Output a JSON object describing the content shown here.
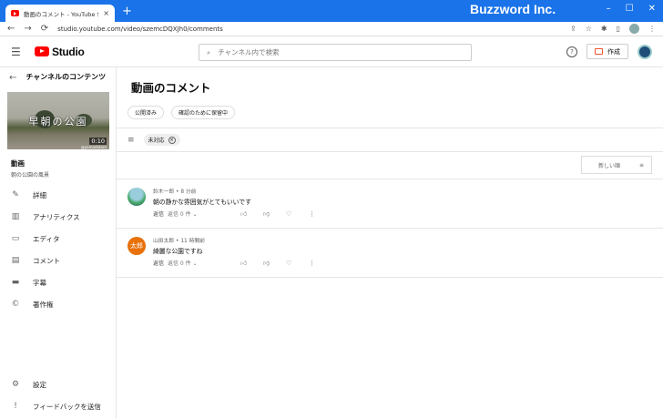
{
  "browser": {
    "tab_title": "動画のコメント - YouTube Studio",
    "tab_close": "×",
    "new_tab": "+",
    "brand": "Buzzword Inc.",
    "url": "studio.youtube.com/video/szemcDQXJh0/comments",
    "controls": [
      "–",
      "☐",
      "✕"
    ]
  },
  "header": {
    "logo_text": "Studio",
    "search_placeholder": "チャンネル内で検索",
    "create_label": "作成",
    "help": "?"
  },
  "sidebar": {
    "title": "チャンネルのコンテンツ",
    "thumb_title": "早朝の公園",
    "thumb_duration": "0:10",
    "thumb_channel": "@yamadataro",
    "video_label": "動画",
    "video_name": "朝の公園の風景",
    "items": [
      {
        "label": "詳細",
        "icon": "pencil-icon"
      },
      {
        "label": "アナリティクス",
        "icon": "analytics-icon"
      },
      {
        "label": "エディタ",
        "icon": "film-icon"
      },
      {
        "label": "コメント",
        "icon": "comment-icon"
      },
      {
        "label": "字幕",
        "icon": "subtitles-icon"
      },
      {
        "label": "著作権",
        "icon": "copyright-icon"
      }
    ],
    "bottom_items": [
      {
        "label": "設定",
        "icon": "gear-icon"
      },
      {
        "label": "フィードバックを送信",
        "icon": "feedback-icon"
      }
    ]
  },
  "main": {
    "title": "動画のコメント",
    "chips": [
      "公開済み",
      "確認のために保留中"
    ],
    "filter_chip": "未対応",
    "sort_label": "新しい順",
    "comments": [
      {
        "author": "鈴木一郎",
        "time": "8 分前",
        "text": "朝の静かな雰囲気がとてもいいです",
        "reply": "返信",
        "replies": "返信 0 件"
      },
      {
        "author": "山田太郎",
        "time": "11 時間前",
        "text": "綺麗な公園ですね",
        "reply": "返信",
        "replies": "返信 0 件",
        "avatar_text": "太郎"
      }
    ]
  },
  "colors": {
    "chrome_blue": "#1a73e8",
    "youtube_red": "#ff0000",
    "avatar_orange": "#e8710a"
  }
}
